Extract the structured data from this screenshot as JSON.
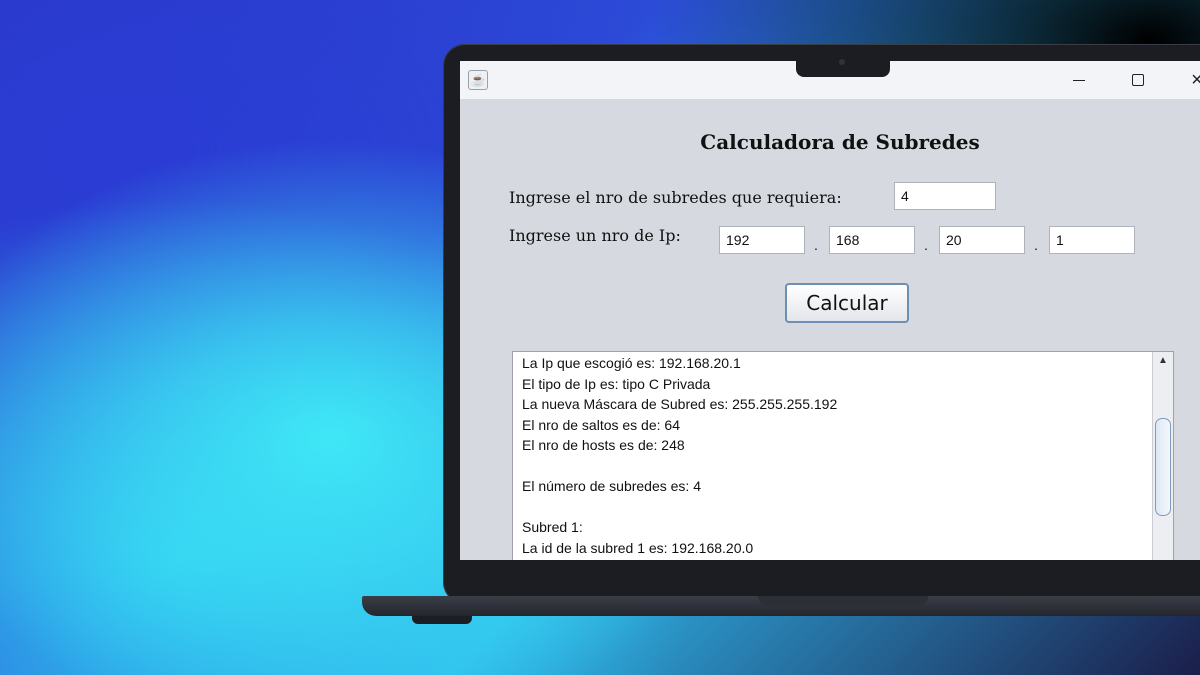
{
  "window": {
    "app_icon": "java-icon",
    "controls": {
      "minimize": "minimize-icon",
      "maximize": "maximize-icon",
      "close_glyph": "×"
    }
  },
  "form": {
    "title": "Calculadora de Subredes",
    "subnets_label": "Ingrese el nro de subredes que requiera:",
    "subnets_value": "4",
    "ip_label": "Ingrese un nro de Ip:",
    "ip_octets": [
      "192",
      "168",
      "20",
      "1"
    ],
    "separator": ".",
    "calculate_button": "Calcular"
  },
  "output": {
    "lines": [
      "La Ip que escogió es: 192.168.20.1",
      "El tipo de Ip es: tipo C Privada",
      "La nueva Máscara de Subred es: 255.255.255.192",
      "El nro de saltos es de: 64",
      "El nro de hosts es de: 248",
      "",
      "El número de subredes es: 4",
      "",
      "Subred 1:",
      "La id de la subred 1 es: 192.168.20.0"
    ]
  }
}
